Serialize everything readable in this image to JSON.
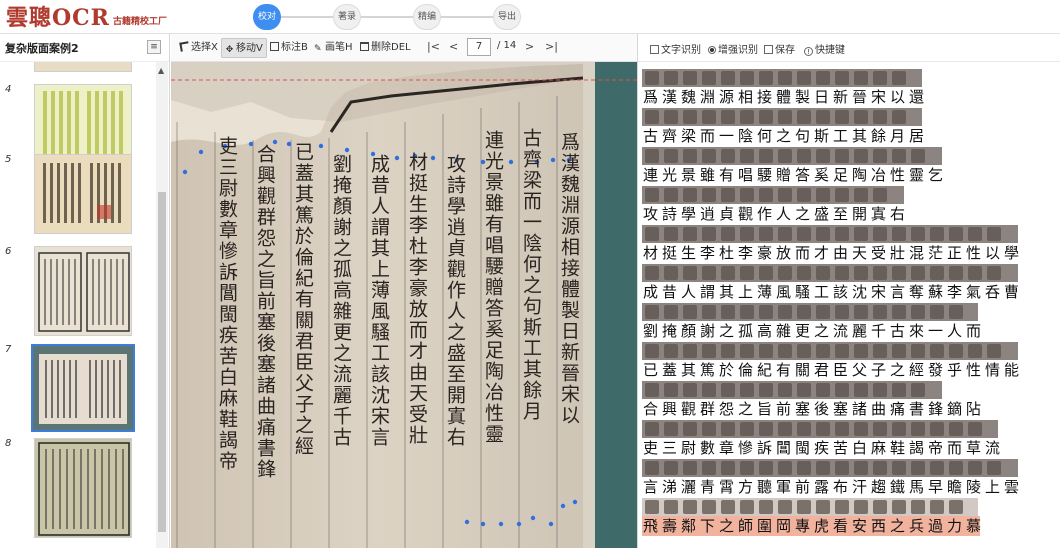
{
  "header": {
    "logo_main": "雲聰OCR",
    "logo_sub": "古籍精校工厂",
    "steps": [
      {
        "label": "校对",
        "active": true
      },
      {
        "label": "著录",
        "active": false
      },
      {
        "label": "精编",
        "active": false
      },
      {
        "label": "导出",
        "active": false
      }
    ]
  },
  "sidebar": {
    "title": "复杂版面案例2",
    "menu_icon": "menu-icon",
    "pages": [
      {
        "num": "4",
        "selected": false
      },
      {
        "num": "5",
        "selected": false
      },
      {
        "num": "6",
        "selected": false
      },
      {
        "num": "7",
        "selected": true
      },
      {
        "num": "8",
        "selected": false
      }
    ]
  },
  "toolbar": {
    "select": "选择X",
    "move": "移动V",
    "mark": "标注B",
    "brush": "画笔H",
    "delete": "删除DEL",
    "page_current": "7",
    "page_total": "/ 14"
  },
  "right_toolbar": {
    "text_recognition": "文字识别",
    "enhanced_recognition": "增强识别",
    "save": "保存",
    "shortcuts": "快捷键"
  },
  "ocr_lines": [
    "爲漢魏淵源相接體製日新晉宋以還",
    "古齊梁而一陰何之句斯工其餘月居",
    "連光景雖有唱騕贈答奚足陶冶性靈乞",
    "攻詩學逍貞觀作人之盛至開寘右",
    "材挺生李杜李豪放而才由天受壯混茫正性以學",
    "成昔人謂其上薄風騷工該沈宋言奪蘇李氣呑曹",
    "劉掩顏謝之孤高雜更之流麗千古來一人而",
    "已蓋其篤於倫紀有關君臣父子之經發乎性情能",
    "合興觀群怨之旨前塞後塞諸曲痛書鋒鏑阽",
    "吏三尉數章慘訴閶閩疾苦白麻鞋謁帝而草流",
    "言涕灑青霄方聽軍前露布汗趨鐵馬早瞻陵上雲",
    "飛壽鄰下之師圍岡專虎看安西之兵過力慕"
  ],
  "colors": {
    "accent": "#3d8ef0",
    "logo": "#b03a2e",
    "highlight": "#f2b39e",
    "marker": "#2f6fe0",
    "guide_line": "#e05050"
  },
  "document_columns": [
    "爲漢魏淵源相接體製日新晉宋以",
    "古齊梁而一陰何之句斯工其餘月",
    "連光景雖有唱騕贈答奚足陶冶性靈",
    "攻詩學逍貞觀作人之盛至開寘右",
    "材挺生李杜李豪放而才由天受壯",
    "成昔人謂其上薄風騷工該沈宋言",
    "劉掩顏謝之孤高雜更之流麗千古",
    "已蓋其篤於倫紀有關君臣父子之經",
    "合興觀群怨之旨前塞後塞諸曲痛書鋒",
    "吏三尉數章慘訴閶閩疾苦白麻鞋謁帝"
  ]
}
